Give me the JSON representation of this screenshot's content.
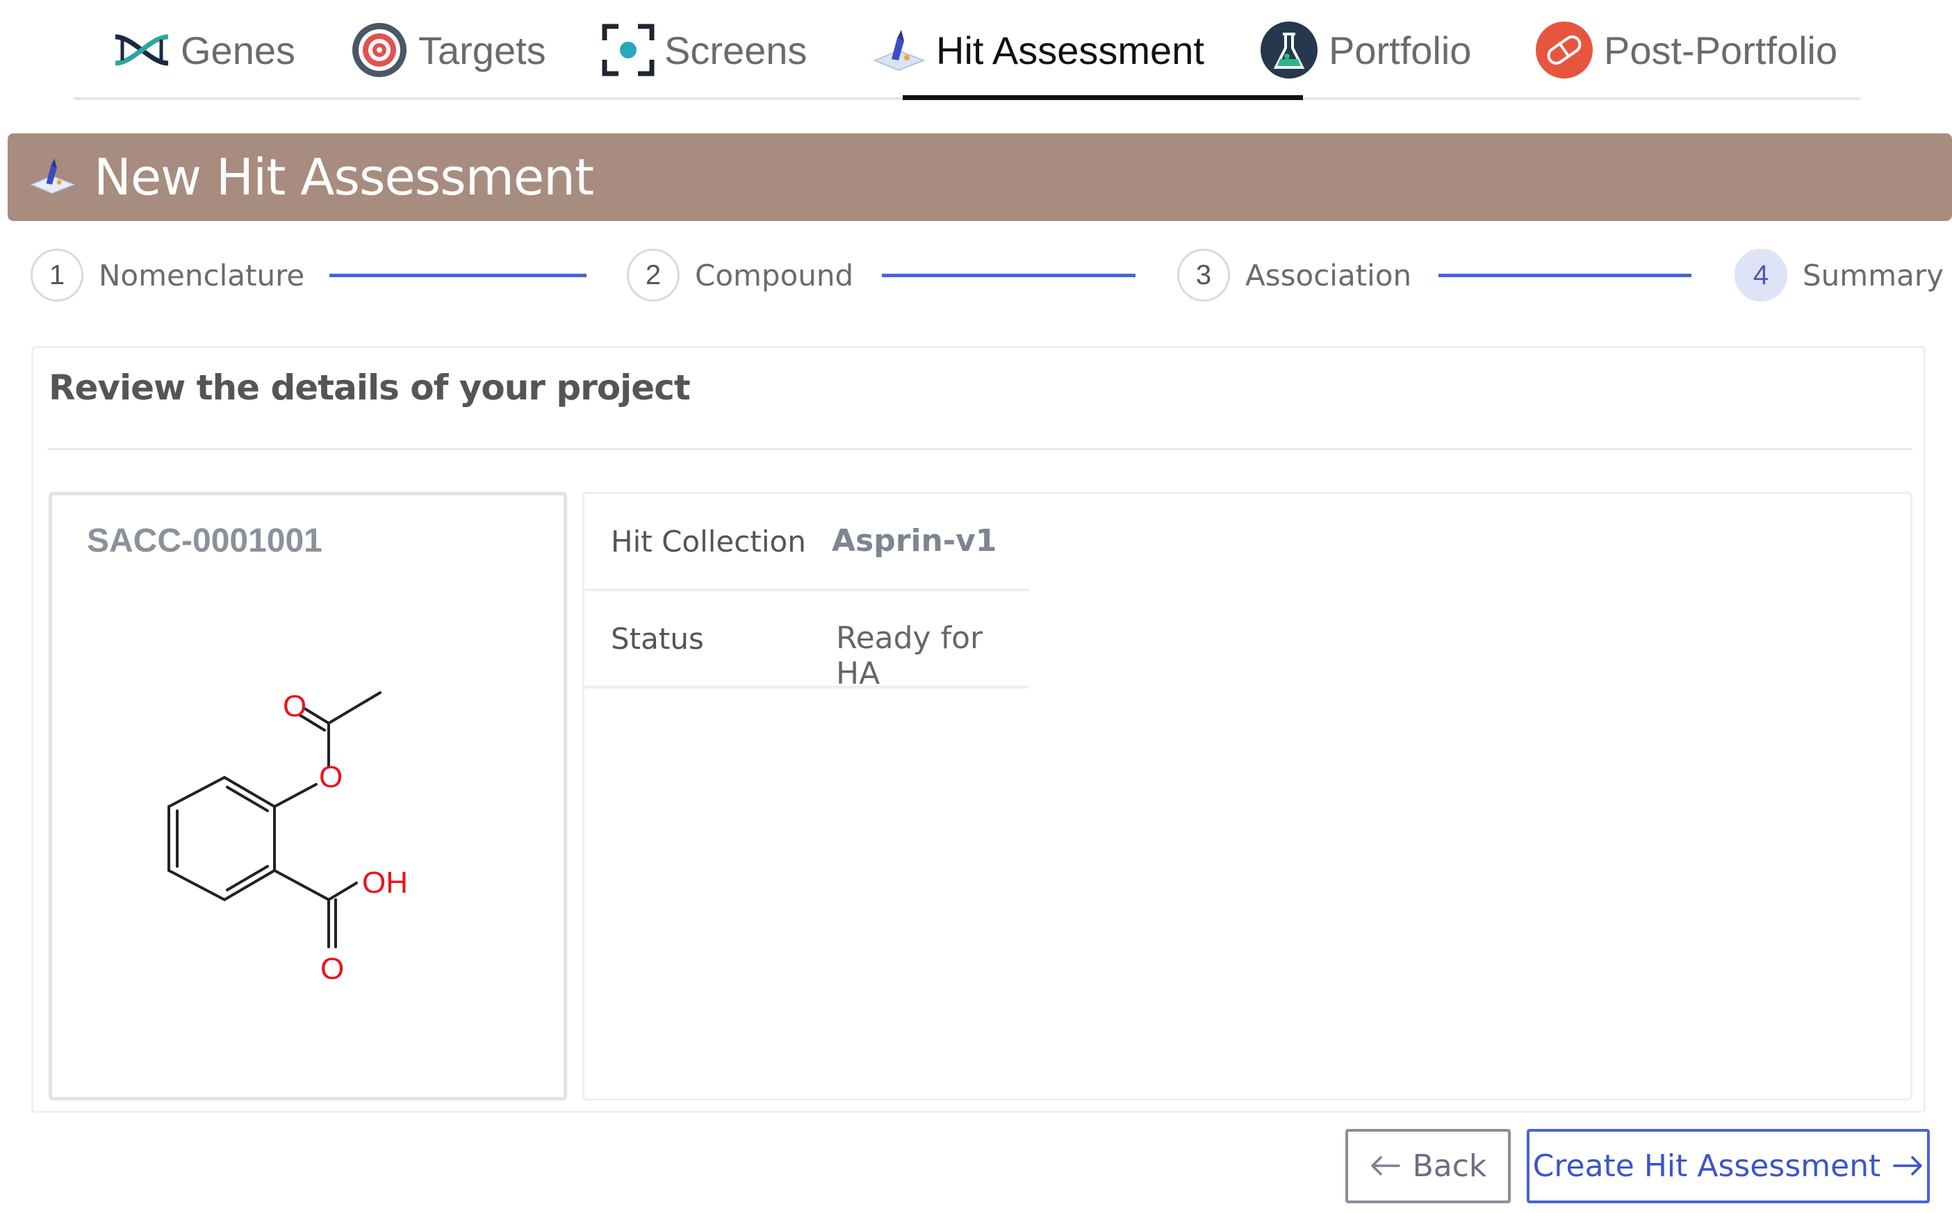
{
  "nav": {
    "tabs": [
      {
        "label": "Genes",
        "icon": "dna-icon"
      },
      {
        "label": "Targets",
        "icon": "target-icon"
      },
      {
        "label": "Screens",
        "icon": "screen-focus-icon"
      },
      {
        "label": "Hit Assessment",
        "icon": "flask-pen-icon",
        "active": true
      },
      {
        "label": "Portfolio",
        "icon": "flask-avatar-icon"
      },
      {
        "label": "Post-Portfolio",
        "icon": "pill-icon"
      }
    ]
  },
  "banner": {
    "title": "New Hit Assessment",
    "color": "#a78c7f"
  },
  "stepper": {
    "steps": [
      {
        "number": "1",
        "label": "Nomenclature"
      },
      {
        "number": "2",
        "label": "Compound"
      },
      {
        "number": "3",
        "label": "Association"
      },
      {
        "number": "4",
        "label": "Summary",
        "active": true
      }
    ],
    "line_color": "#4a63d6"
  },
  "review": {
    "title": "Review the details of your project",
    "compound": {
      "id": "SACC-0001001",
      "structure_labels": {
        "o1": "O",
        "o2": "O",
        "oh": "OH",
        "o3": "O"
      }
    },
    "details": [
      {
        "label": "Hit Collection",
        "value": "Asprin-v1"
      },
      {
        "label": "Status",
        "value": "Ready for HA"
      }
    ]
  },
  "actions": {
    "back_label": "Back",
    "create_label": "Create Hit Assessment"
  }
}
